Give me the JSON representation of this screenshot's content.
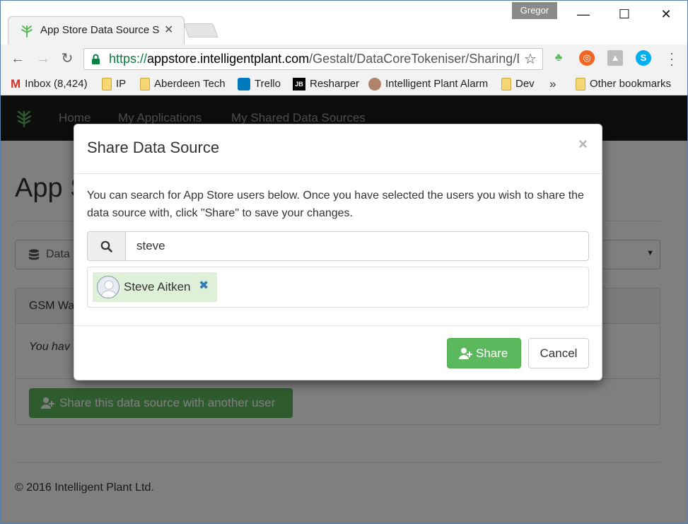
{
  "browser": {
    "tab_title": "App Store Data Source Sh",
    "profile_name": "Gregor",
    "url_scheme": "https://",
    "url_host": "appstore.intelligentplant.com",
    "url_path": "/Gestalt/DataCoreTokeniser/Sharing/D",
    "bookmarks": [
      {
        "label": "Inbox (8,424)",
        "icon": "gmail-icon"
      },
      {
        "label": "IP",
        "icon": "folder-icon"
      },
      {
        "label": "Aberdeen Tech",
        "icon": "folder-icon"
      },
      {
        "label": "Trello",
        "icon": "trello-icon"
      },
      {
        "label": "Resharper",
        "icon": "jetbrains-icon"
      },
      {
        "label": "Intelligent Plant Alarm",
        "icon": "alarm-app-icon"
      },
      {
        "label": "Dev",
        "icon": "folder-icon"
      }
    ],
    "bookmarks_overflow": "»",
    "other_bookmarks": "Other bookmarks"
  },
  "site": {
    "nav": [
      "Home",
      "My Applications",
      "My Shared Data Sources"
    ],
    "page_title": "App S",
    "datasource_label": "Data",
    "panel_title": "GSM Wa",
    "panel_text": "You hav",
    "share_another_button": "Share this data source with another user",
    "footer": "© 2016 Intelligent Plant Ltd."
  },
  "modal": {
    "title": "Share Data Source",
    "close_glyph": "×",
    "description": "You can search for App Store users below. Once you have selected the users you wish to share the data source with, click \"Share\" to save your changes.",
    "search_value": "steve",
    "selected_users": [
      {
        "name": "Steve Aitken"
      }
    ],
    "share_button": "Share",
    "cancel_button": "Cancel"
  },
  "colors": {
    "brand_green": "#5cb85c",
    "navbar": "#1a1a1a",
    "chip_bg": "#dff0d8",
    "link_blue": "#337ab7"
  }
}
